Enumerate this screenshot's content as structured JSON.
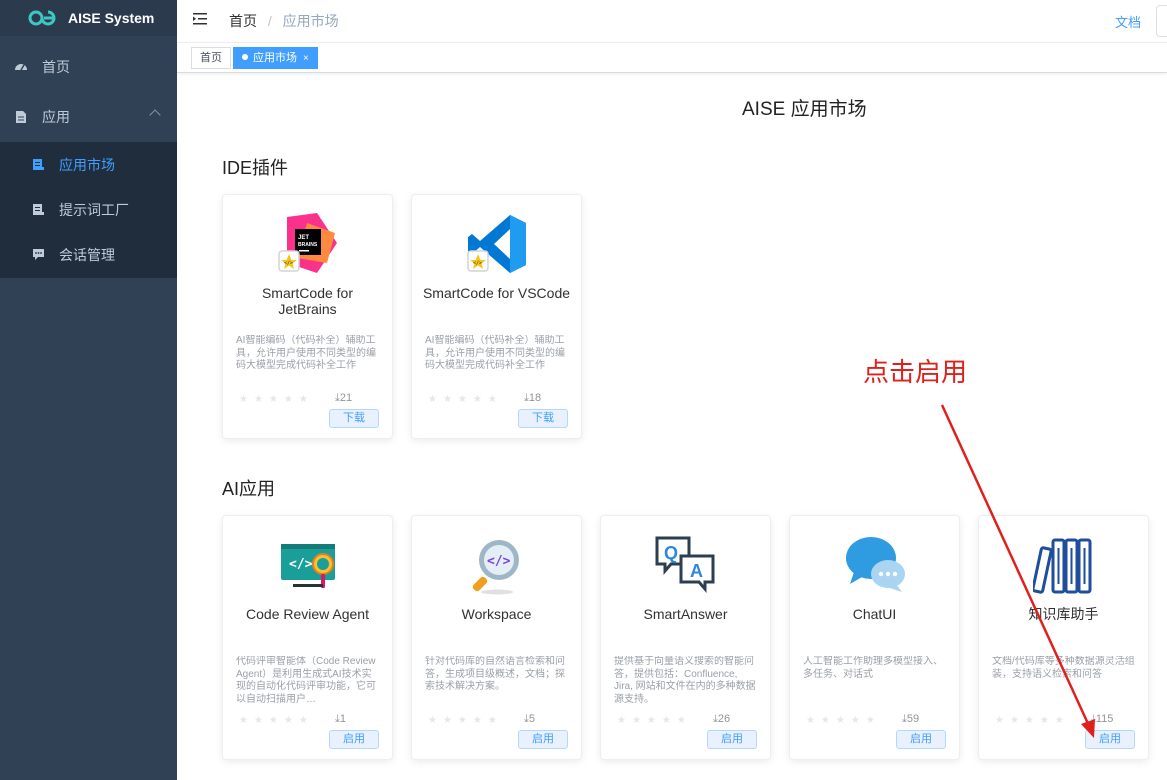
{
  "brand": {
    "title": "AISE System",
    "logo": "aise-logo"
  },
  "sidebar": {
    "items": [
      {
        "label": "首页",
        "icon": "dashboard-icon"
      },
      {
        "label": "应用",
        "icon": "document-icon",
        "expanded": true
      }
    ],
    "sub_items": [
      {
        "label": "应用市场",
        "icon": "list-doc-icon",
        "active": true
      },
      {
        "label": "提示词工厂",
        "icon": "list-doc-icon",
        "active": false
      },
      {
        "label": "会话管理",
        "icon": "chat-bubble-icon",
        "active": false
      }
    ]
  },
  "navbar": {
    "breadcrumb": {
      "home": "首页",
      "separator": "/",
      "current": "应用市场"
    },
    "docs_label": "文档"
  },
  "tags": [
    {
      "label": "首页",
      "active": false
    },
    {
      "label": "应用市场",
      "active": true,
      "close": "×"
    }
  ],
  "main": {
    "title": "AISE 应用市场",
    "sections": [
      {
        "title": "IDE插件",
        "cards": [
          {
            "name": "SmartCode for JetBrains",
            "icon": "jetbrains-plugin-icon",
            "desc": "AI智能编码（代码补全）辅助工具，允许用户使用不同类型的编码大模型完成代码补全工作",
            "rating": 0,
            "downloads": "21",
            "button": "下载"
          },
          {
            "name": "SmartCode for VSCode",
            "icon": "vscode-plugin-icon",
            "desc": "AI智能编码（代码补全）辅助工具，允许用户使用不同类型的编码大模型完成代码补全工作",
            "rating": 0,
            "downloads": "18",
            "button": "下载"
          }
        ]
      },
      {
        "title": "AI应用",
        "cards": [
          {
            "name": "Code Review Agent",
            "icon": "code-review-icon",
            "desc": "代码评审智能体（Code Review Agent）是利用生成式AI技术实现的自动化代码评审功能，它可以自动扫描用户…",
            "rating": 0,
            "downloads": "1",
            "button": "启用"
          },
          {
            "name": "Workspace",
            "icon": "code-search-icon",
            "desc": "针对代码库的自然语言检索和问答，生成项目级概述，文档；探索技术解决方案。",
            "rating": 0,
            "downloads": "5",
            "button": "启用"
          },
          {
            "name": "SmartAnswer",
            "icon": "qa-bubbles-icon",
            "desc": "提供基于向量语义搜索的智能问答，提供包括：Confluence, Jira, 网站和文件在内的多种数据源支持。",
            "rating": 0,
            "downloads": "26",
            "button": "启用"
          },
          {
            "name": "ChatUI",
            "icon": "chat-bubbles-icon",
            "desc": "人工智能工作助理多模型接入、多任务、对话式",
            "rating": 0,
            "downloads": "59",
            "button": "启用"
          },
          {
            "name": "知识库助手",
            "icon": "books-icon",
            "desc": "文档/代码库等多种数据源灵活组装，支持语义检索和问答",
            "rating": 0,
            "downloads": "115",
            "button": "启用"
          }
        ]
      }
    ]
  },
  "annotation": {
    "text": "点击启用",
    "color": "#e0201c"
  },
  "colors": {
    "sidebar_bg": "#304156",
    "submenu_bg": "#1f2d3d",
    "accent": "#409eff"
  }
}
